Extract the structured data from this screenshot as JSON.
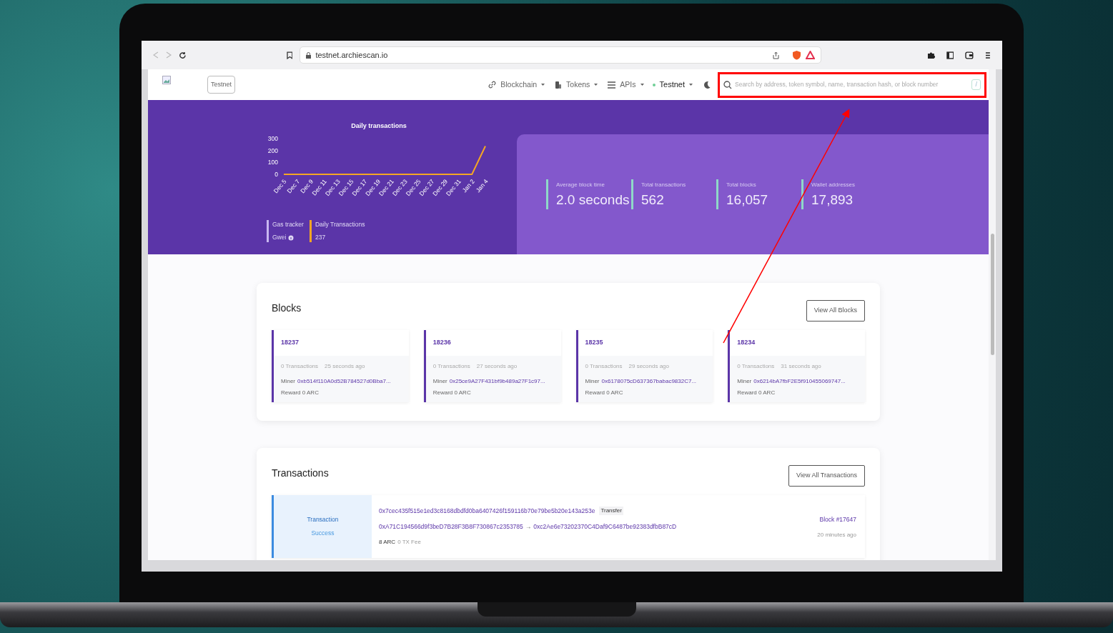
{
  "browser": {
    "url": "testnet.archiescan.io"
  },
  "nav": {
    "network_badge": "Testnet",
    "links": [
      {
        "kind": "link",
        "label": "Blockchain"
      },
      {
        "kind": "tokens",
        "label": "Tokens"
      },
      {
        "kind": "list",
        "label": "APIs"
      }
    ],
    "network": {
      "label": "Testnet"
    },
    "search": {
      "placeholder": "Search by address, token symbol, name, transaction hash, or block number",
      "shortcut": "/"
    }
  },
  "hero": {
    "chart_data": {
      "type": "line",
      "title": "Daily transactions",
      "categories": [
        "Dec 5",
        "Dec 7",
        "Dec 9",
        "Dec 11",
        "Dec 13",
        "Dec 15",
        "Dec 17",
        "Dec 19",
        "Dec 21",
        "Dec 23",
        "Dec 25",
        "Dec 27",
        "Dec 29",
        "Dec 31",
        "Jan 2",
        "Jan 4"
      ],
      "series": [
        {
          "color": "#f5a623",
          "values": [
            0,
            0,
            0,
            0,
            0,
            0,
            0,
            0,
            0,
            0,
            0,
            0,
            0,
            0,
            0,
            237
          ]
        }
      ],
      "ylim": [
        0,
        300
      ],
      "yticks": [
        0,
        100,
        200,
        300
      ]
    },
    "gas_tracker": {
      "label": "Gas tracker",
      "unit": "Gwei"
    },
    "daily": {
      "label": "Daily Transactions",
      "value": "237"
    },
    "stats": [
      {
        "label": "Average block time",
        "value": "2.0 seconds"
      },
      {
        "label": "Total transactions",
        "value": "562"
      },
      {
        "label": "Total blocks",
        "value": "16,057"
      },
      {
        "label": "Wallet addresses",
        "value": "17,893"
      }
    ]
  },
  "blocks": {
    "title": "Blocks",
    "button": "View All Blocks",
    "items": [
      {
        "number": "18237",
        "transactions": "0 Transactions",
        "age": "25 seconds ago",
        "miner_label": "Miner",
        "miner": "0xb514f110A0d52B784527d0Bba7...",
        "reward": "Reward 0 ARC"
      },
      {
        "number": "18236",
        "transactions": "0 Transactions",
        "age": "27 seconds ago",
        "miner_label": "Miner",
        "miner": "0x25ce9A27F431bf9b489a27F1c97...",
        "reward": "Reward 0 ARC"
      },
      {
        "number": "18235",
        "transactions": "0 Transactions",
        "age": "29 seconds ago",
        "miner_label": "Miner",
        "miner": "0x6178075cD637367babac9832C7...",
        "reward": "Reward 0 ARC"
      },
      {
        "number": "18234",
        "transactions": "0 Transactions",
        "age": "31 seconds ago",
        "miner_label": "Miner",
        "miner": "0x6214bA7fbF2E5f910455069747...",
        "reward": "Reward 0 ARC"
      }
    ]
  },
  "transactions": {
    "title": "Transactions",
    "button": "View All Transactions",
    "items": [
      {
        "type": "Transaction",
        "status": "Success",
        "hash": "0x7cec435f515e1ed3c8168dbdfd0ba6407426f159116b70e79be5b20e143a253e",
        "tag": "Transfer",
        "from": "0xA71C194566d9f3beD7B28F3B8F730867c2353785",
        "arrow": "→",
        "to": "0xc2Ae6e73202370C4Daf9C6487be92383dfbB87cD",
        "value": "8 ARC",
        "fee": "0 TX Fee",
        "block": "Block #17647",
        "age": "20 minutes ago"
      }
    ]
  }
}
